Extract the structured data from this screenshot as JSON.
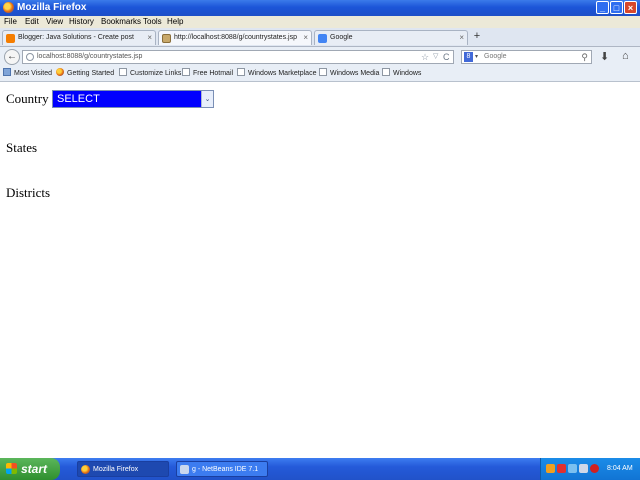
{
  "window": {
    "title": "Mozilla Firefox",
    "controls": {
      "minimize": "_",
      "maximize": "□",
      "close": "×"
    }
  },
  "menu": [
    "File",
    "Edit",
    "View",
    "History",
    "Bookmarks",
    "Tools",
    "Help"
  ],
  "tabs": [
    {
      "label": "Blogger: Java Solutions - Create post",
      "close": "×"
    },
    {
      "label": "http://localhost:8088/g/countrystates.jsp",
      "close": "×"
    },
    {
      "label": "Google",
      "close": "×"
    }
  ],
  "new_tab": "+",
  "nav": {
    "back": "←",
    "url": "localhost:8088/g/countrystates.jsp",
    "star": "☆",
    "drop": "▽",
    "reload": "C",
    "search_engine": "8",
    "search_drop": "▾",
    "search_placeholder": "Google",
    "search_icon": "⚲",
    "download": "⬇",
    "home": "⌂"
  },
  "bookmarks": [
    "Most Visited",
    "Getting Started",
    "Customize Links",
    "Free Hotmail",
    "Windows Marketplace",
    "Windows Media",
    "Windows"
  ],
  "page": {
    "country_label": "Country",
    "country_selected": "SELECT",
    "select_arrow": "⌄",
    "states_label": "States",
    "districts_label": "Districts"
  },
  "taskbar": {
    "start": "start",
    "items": [
      {
        "label": "Mozilla Firefox"
      },
      {
        "label": "g - NetBeans IDE 7.1"
      }
    ],
    "clock": "8:04 AM"
  }
}
